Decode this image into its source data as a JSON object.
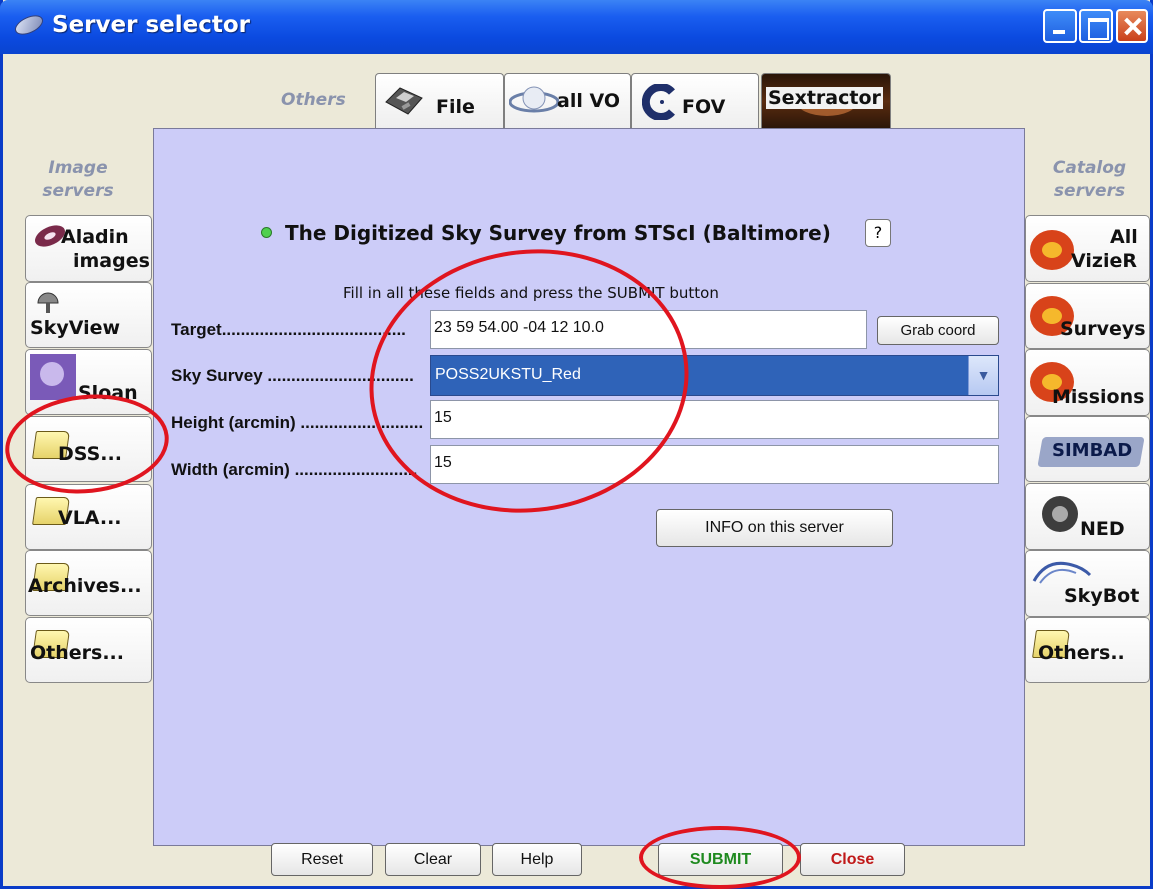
{
  "window": {
    "title": "Server selector"
  },
  "groups": {
    "others": "Others",
    "image_servers": [
      "Image",
      "servers"
    ],
    "catalog_servers": [
      "Catalog",
      "servers"
    ]
  },
  "top_tabs": [
    {
      "label": "File",
      "icon": "floppy-disk-icon"
    },
    {
      "label": "all VO",
      "icon": "saturn-icon"
    },
    {
      "label": "FOV",
      "icon": "fov-c-icon"
    },
    {
      "label": "Sextractor",
      "icon": "galaxy-icon"
    }
  ],
  "image_servers": [
    {
      "label": [
        "Aladin",
        "images"
      ],
      "icon": "aladin-galaxy-icon"
    },
    {
      "label": [
        "SkyView"
      ],
      "icon": "telescope-icon"
    },
    {
      "label": [
        "Sloan"
      ],
      "icon": "sloan-icon"
    },
    {
      "label": [
        "DSS..."
      ],
      "icon": "folder-icon"
    },
    {
      "label": [
        "VLA..."
      ],
      "icon": "folder-icon"
    },
    {
      "label": [
        "Archives..."
      ],
      "icon": "folder-icon"
    },
    {
      "label": [
        "Others..."
      ],
      "icon": "folder-icon"
    }
  ],
  "catalog_servers": [
    {
      "label": [
        "All",
        "VizieR"
      ],
      "icon": "vizier-swirl-icon"
    },
    {
      "label": [
        "Surveys"
      ],
      "icon": "vizier-swirl-icon"
    },
    {
      "label": [
        "Missions"
      ],
      "icon": "vizier-swirl-icon"
    },
    {
      "label": [
        "SIMBAD"
      ],
      "icon": "simbad-logo-icon"
    },
    {
      "label": [
        "NED"
      ],
      "icon": "ned-logo-icon"
    },
    {
      "label": [
        "SkyBot"
      ],
      "icon": "skybot-logo-icon"
    },
    {
      "label": [
        "Others.."
      ],
      "icon": "folder-icon"
    }
  ],
  "form": {
    "heading": "The Digitized Sky Survey from STScI (Baltimore)",
    "help": "?",
    "instructions": "Fill in all these fields and press the SUBMIT button",
    "target_label": "Target.......................................",
    "target_value": "23 59 54.00 -04 12 10.0",
    "grab_coord": "Grab coord",
    "survey_label": "Sky Survey ...............................",
    "survey_value": "POSS2UKSTU_Red",
    "height_label": "Height (arcmin) ..........................",
    "height_value": "15",
    "width_label": "Width (arcmin) ..........................",
    "width_value": "15",
    "info_button": "INFO on this server"
  },
  "footer": {
    "reset": "Reset",
    "clear": "Clear",
    "help": "Help",
    "submit": "SUBMIT",
    "close": "Close"
  },
  "colors": {
    "panel": "#ccccf8",
    "submit_text": "#1f8a1f",
    "close_text": "#c01818",
    "annotation": "#e0151f",
    "selected": "#2f63b8"
  }
}
